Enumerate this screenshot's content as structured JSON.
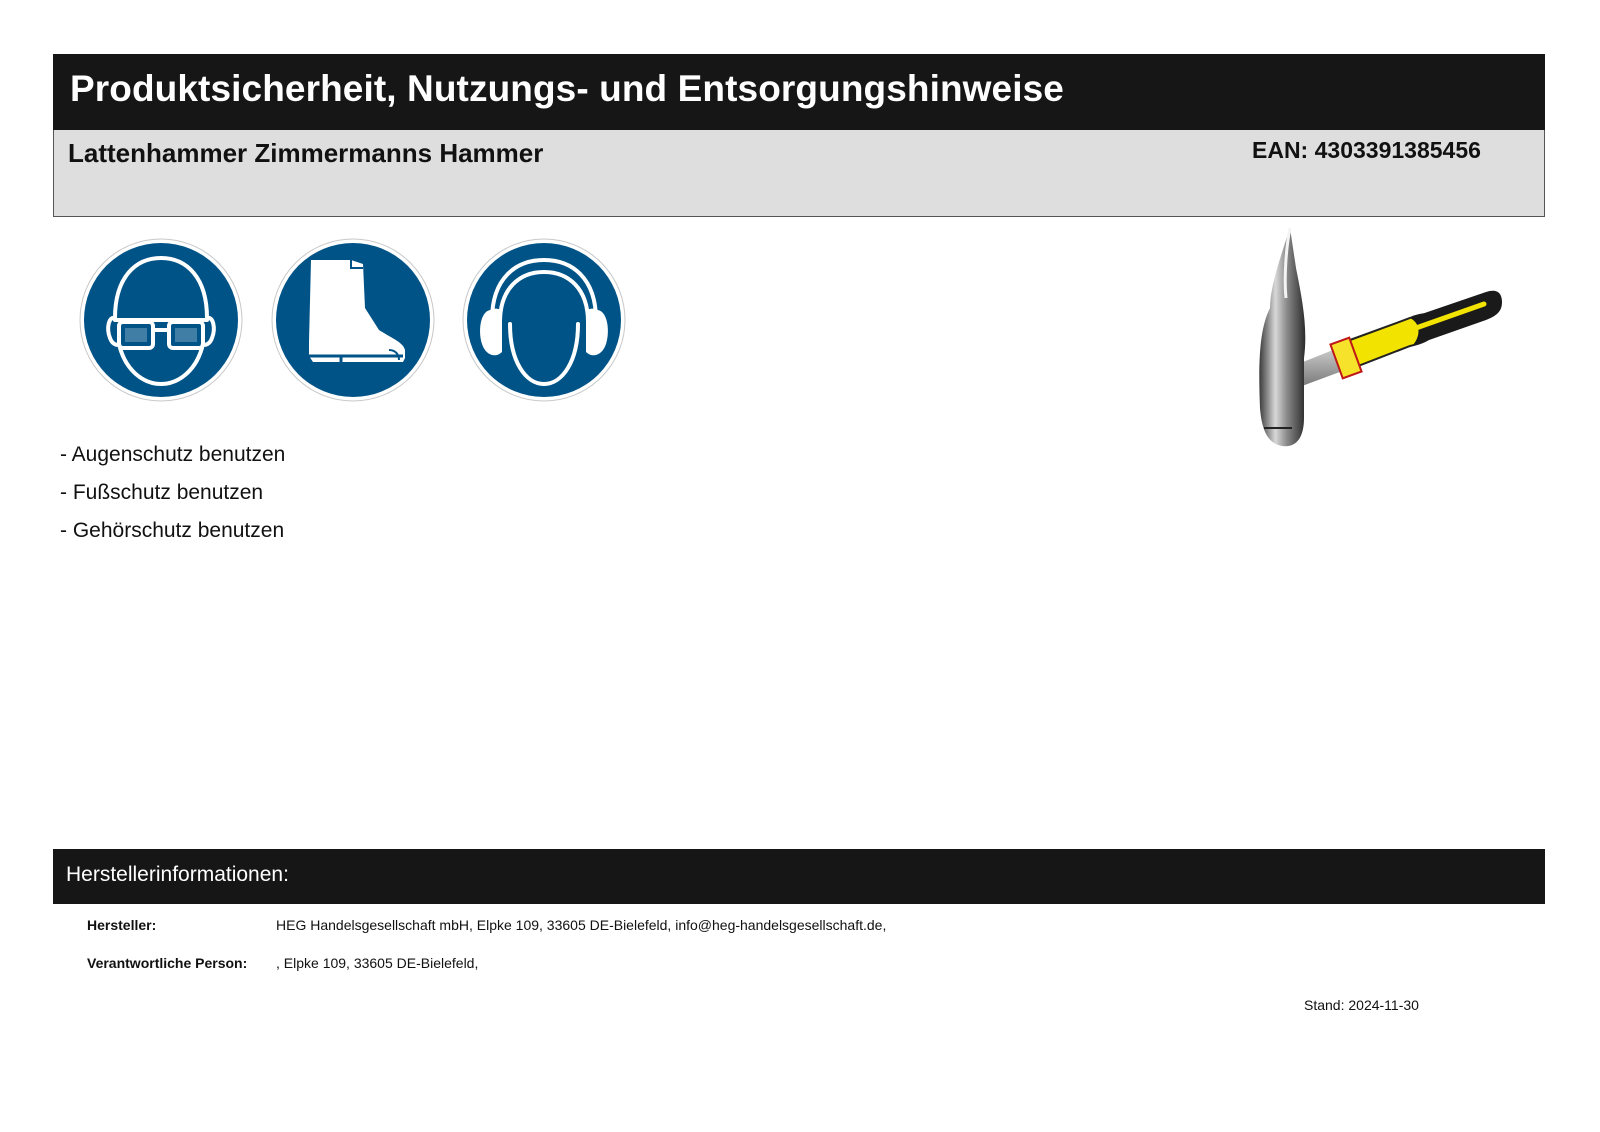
{
  "header": {
    "title": "Produktsicherheit, Nutzungs- und Entsorgungshinweise",
    "product_name": "Lattenhammer Zimmermanns Hammer",
    "ean": "EAN: 4303391385456"
  },
  "safety_signs": [
    {
      "icon": "eye-protection-icon"
    },
    {
      "icon": "foot-protection-icon"
    },
    {
      "icon": "hearing-protection-icon"
    }
  ],
  "instructions": [
    "- Augenschutz benutzen",
    "- Fußschutz benutzen",
    "- Gehörschutz benutzen"
  ],
  "product_image": {
    "icon": "hammer-image"
  },
  "manufacturer": {
    "heading": "Herstellerinformationen:",
    "rows": [
      {
        "label": "Hersteller:",
        "value": "HEG Handelsgesellschaft mbH, Elpke 109, 33605 DE-Bielefeld, info@heg-handelsgesellschaft.de,"
      },
      {
        "label": "Verantwortliche Person:",
        "value": ", Elpke 109, 33605 DE-Bielefeld,"
      }
    ]
  },
  "stand": "Stand: 2024-11-30",
  "colors": {
    "sign_blue": "#005387",
    "bar_dark": "#161616",
    "bar_light": "#dedede",
    "handle_yellow": "#f2e400"
  }
}
